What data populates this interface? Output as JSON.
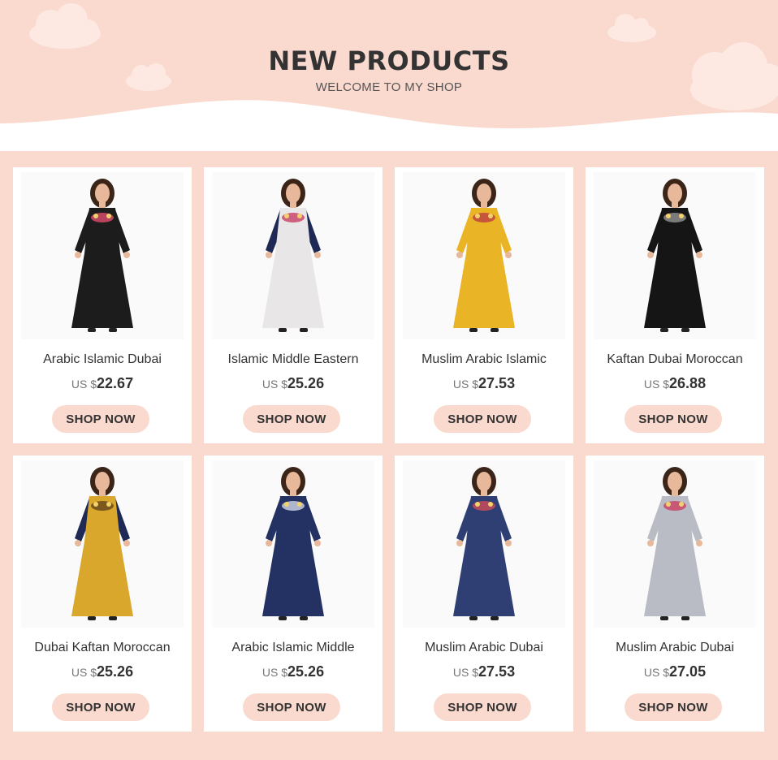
{
  "header": {
    "title": "NEW PRODUCTS",
    "subtitle": "WELCOME TO MY SHOP"
  },
  "products": [
    {
      "name": "Arabic Islamic Dubai",
      "currency": "US $",
      "price": "22.67",
      "button": "SHOP NOW",
      "colors": {
        "dress": "#1c1c1c",
        "accent": "#d24a6a",
        "sleeve": "#1c1c1c"
      }
    },
    {
      "name": "Islamic Middle Eastern",
      "currency": "US $",
      "price": "25.26",
      "button": "SHOP NOW",
      "colors": {
        "dress": "#e9e6e8",
        "accent": "#c9476b",
        "sleeve": "#1e2a55"
      }
    },
    {
      "name": "Muslim Arabic Islamic",
      "currency": "US $",
      "price": "27.53",
      "button": "SHOP NOW",
      "colors": {
        "dress": "#e9b426",
        "accent": "#c0443f",
        "sleeve": "#e9b426"
      }
    },
    {
      "name": "Kaftan Dubai Moroccan",
      "currency": "US $",
      "price": "26.88",
      "button": "SHOP NOW",
      "colors": {
        "dress": "#151515",
        "accent": "#8c8c8c",
        "sleeve": "#151515"
      }
    },
    {
      "name": "Dubai Kaftan Moroccan",
      "currency": "US $",
      "price": "25.26",
      "button": "SHOP NOW",
      "colors": {
        "dress": "#d9a72b",
        "accent": "#6b4a1a",
        "sleeve": "#1e2a55"
      }
    },
    {
      "name": "Arabic Islamic Middle",
      "currency": "US $",
      "price": "25.26",
      "button": "SHOP NOW",
      "colors": {
        "dress": "#243163",
        "accent": "#c9cde0",
        "sleeve": "#243163"
      }
    },
    {
      "name": "Muslim Arabic Dubai",
      "currency": "US $",
      "price": "27.53",
      "button": "SHOP NOW",
      "colors": {
        "dress": "#2f3f73",
        "accent": "#c44b5a",
        "sleeve": "#2f3f73"
      }
    },
    {
      "name": "Muslim Arabic Dubai",
      "currency": "US $",
      "price": "27.05",
      "button": "SHOP NOW",
      "colors": {
        "dress": "#b9bcc4",
        "accent": "#c9476b",
        "sleeve": "#b9bcc4"
      }
    }
  ]
}
